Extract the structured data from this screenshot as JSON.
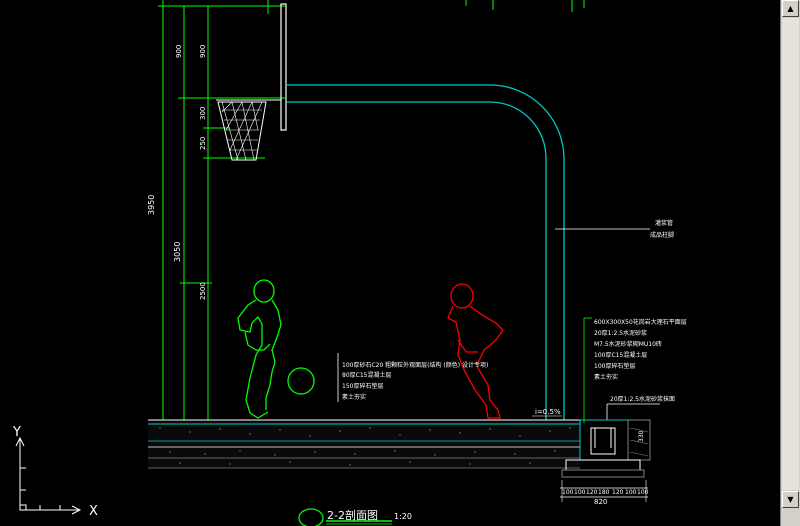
{
  "colors": {
    "background": "#000000",
    "green": "#00ff00",
    "cyan": "#00c8c8",
    "white": "#ffffff",
    "red": "#ff0000",
    "gray": "#808080"
  },
  "dimensions_left": {
    "total": "3950",
    "main": "3050",
    "top_900_a": "900",
    "top_900_b": "900",
    "seg_300": "300",
    "seg_250": "250",
    "seg_2500": "2500"
  },
  "annotations_pole": [
    "灌浆管",
    "成品柱脚"
  ],
  "annotations_left_layers": [
    "100厚砂石C20 粗颗粒外观面层(结构 (颜色) 设计专项)",
    "80厚C15混凝土层",
    "150厚碎石垫层",
    "素土夯实"
  ],
  "annotations_right_layers": [
    "600X300X50花岗岩大理石平面层",
    "20厚1:2.5水泥砂浆",
    "M7.5水泥砂浆砌MU10砖",
    "100厚C15混凝土层",
    "100厚碎石垫层",
    "素土夯实"
  ],
  "annotation_bottom_right": "20厚1:2.5水泥砂浆抹面",
  "slope_label": "i=0.5%",
  "dim_330": "330",
  "bottom_dims": [
    "100",
    "100",
    "120",
    "180",
    "120",
    "100",
    "100"
  ],
  "bottom_total": "820",
  "section_title": "2-2剖面图",
  "section_scale": "1:20",
  "ucs": {
    "y": "Y",
    "x": "X"
  }
}
